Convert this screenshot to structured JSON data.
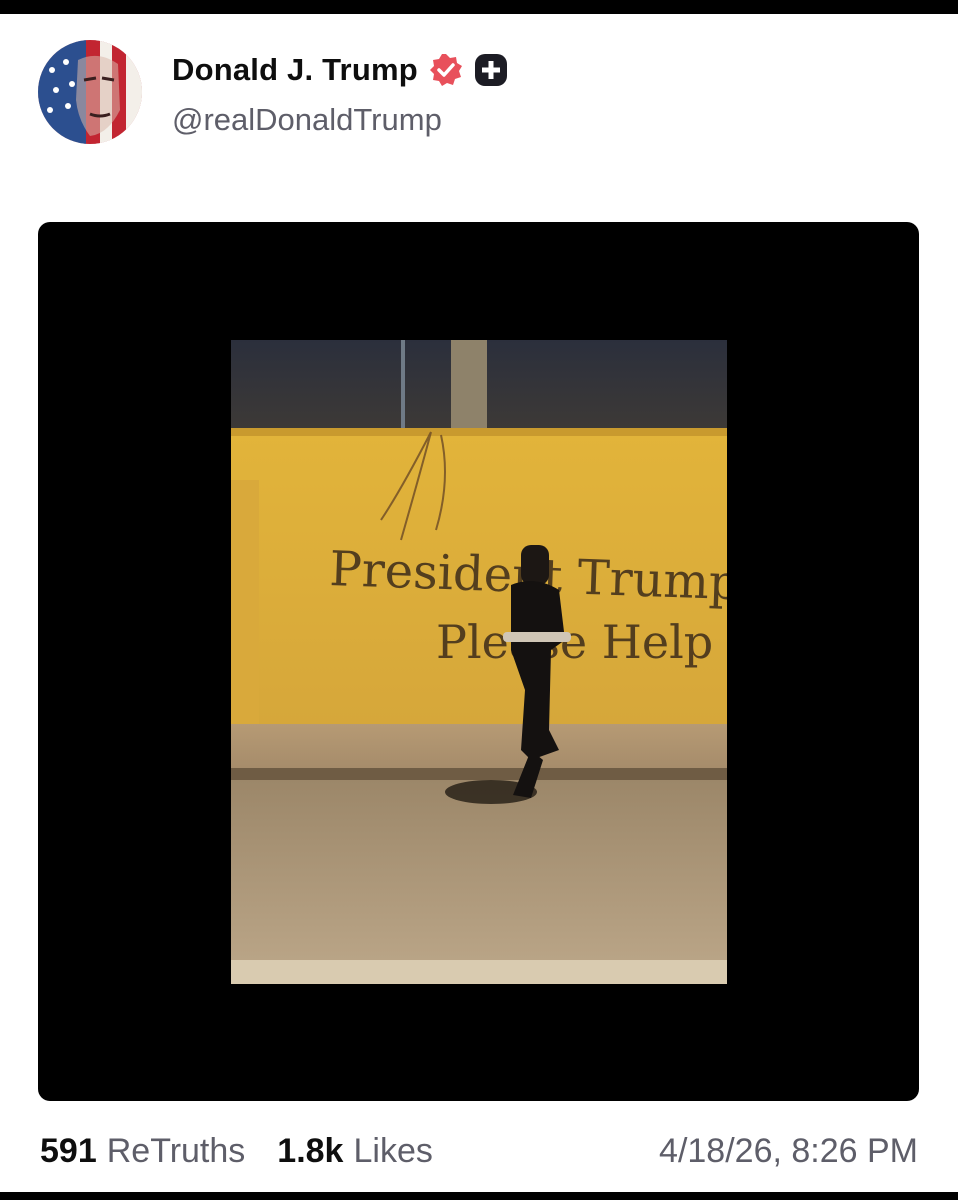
{
  "author": {
    "display_name": "Donald J. Trump",
    "handle": "@realDonaldTrump",
    "avatar_icon": "flag-portrait-avatar",
    "verified_icon": "verified-badge-icon",
    "plus_icon": "plus-badge-icon",
    "verified_color": "#e8505b"
  },
  "media": {
    "type": "video",
    "wall_text_line1": "President Trump",
    "wall_text_line2": "Please Help"
  },
  "stats": {
    "retruths_count": "591",
    "retruths_label": "ReTruths",
    "likes_count": "1.8k",
    "likes_label": "Likes",
    "timestamp": "4/18/26, 8:26 PM"
  }
}
